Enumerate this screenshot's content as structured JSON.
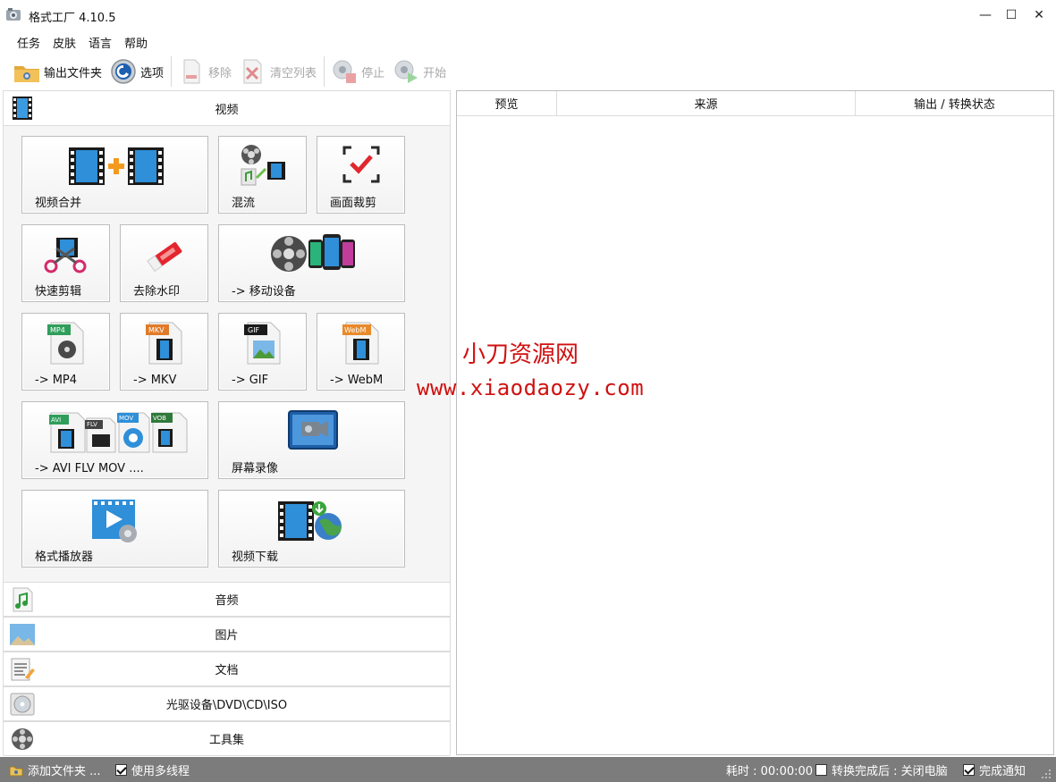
{
  "window": {
    "title": "格式工厂 4.10.5",
    "minimize": "—",
    "maximize": "☐",
    "close": "✕"
  },
  "menu": [
    "任务",
    "皮肤",
    "语言",
    "帮助"
  ],
  "toolbar": {
    "output_folder": "输出文件夹",
    "options": "选项",
    "remove": "移除",
    "clear_list": "清空列表",
    "stop": "停止",
    "start": "开始"
  },
  "categories": {
    "video": "视频",
    "audio": "音频",
    "image": "图片",
    "document": "文档",
    "disc": "光驱设备\\DVD\\CD\\ISO",
    "tools": "工具集"
  },
  "video_tiles": {
    "merge": "视频合并",
    "mux": "混流",
    "crop": "画面裁剪",
    "quick_cut": "快速剪辑",
    "remove_watermark": "去除水印",
    "mobile": "-> 移动设备",
    "mp4": "-> MP4",
    "mkv": "-> MKV",
    "gif": "-> GIF",
    "webm": "-> WebM",
    "avi_flv_mov": "-> AVI FLV MOV ....",
    "screen_record": "屏幕录像",
    "player": "格式播放器",
    "download": "视频下载"
  },
  "file_badges": {
    "mp4": "MP4",
    "mkv": "MKV",
    "gif": "GIF",
    "webm": "WebM",
    "avi": "AVI",
    "flv": "FLV",
    "mov": "MOV",
    "vob": "VOB"
  },
  "task_list": {
    "col_preview": "预览",
    "col_source": "来源",
    "col_status": "输出 / 转换状态"
  },
  "watermark": {
    "line1": "小刀资源网",
    "line2": "www.xiaodaozy.com"
  },
  "statusbar": {
    "add_folder": "添加文件夹 ...",
    "multithread": "使用多线程",
    "multithread_checked": true,
    "elapsed": "耗时 : 00:00:00",
    "shutdown_after": "转换完成后 : 关闭电脑",
    "shutdown_checked": false,
    "notify": "完成通知",
    "notify_checked": true
  },
  "colors": {
    "accent_red": "#d01010",
    "statusbar_bg": "#7c7c7c",
    "film_blue": "#2f8fd8"
  }
}
